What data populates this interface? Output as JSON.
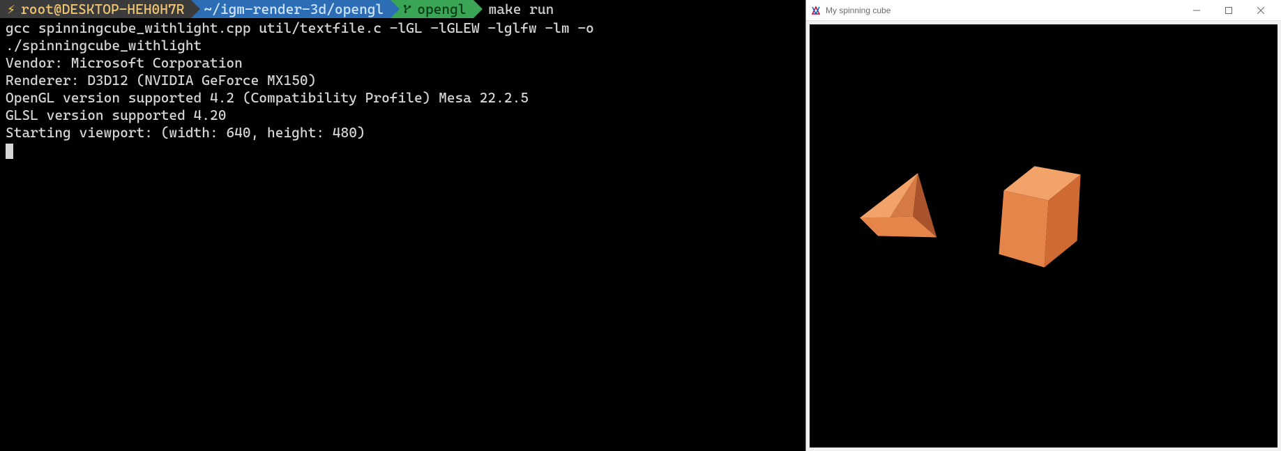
{
  "prompt": {
    "user_host": "root@DESKTOP-HEH0H7R",
    "path": "~/igm-render-3d/opengl",
    "branch": "opengl",
    "command": "make run"
  },
  "output_lines": [
    "gcc spinningcube_withlight.cpp util/textfile.c -lGL -lGLEW -lglfw -lm -o",
    "./spinningcube_withlight",
    "Vendor: Microsoft Corporation",
    "Renderer: D3D12 (NVIDIA GeForce MX150)",
    "OpenGL version supported 4.2 (Compatibility Profile) Mesa 22.2.5",
    "GLSL version supported 4.20",
    "Starting viewport: (width: 640, height: 480)"
  ],
  "window": {
    "title": "My spinning cube"
  },
  "colors": {
    "cube_light": "#f2a36a",
    "cube_mid": "#e6854a",
    "cube_dark": "#cf6a32",
    "pyr_light": "#f2a36a",
    "pyr_mid": "#d57a42",
    "pyr_dark": "#a8532b"
  }
}
